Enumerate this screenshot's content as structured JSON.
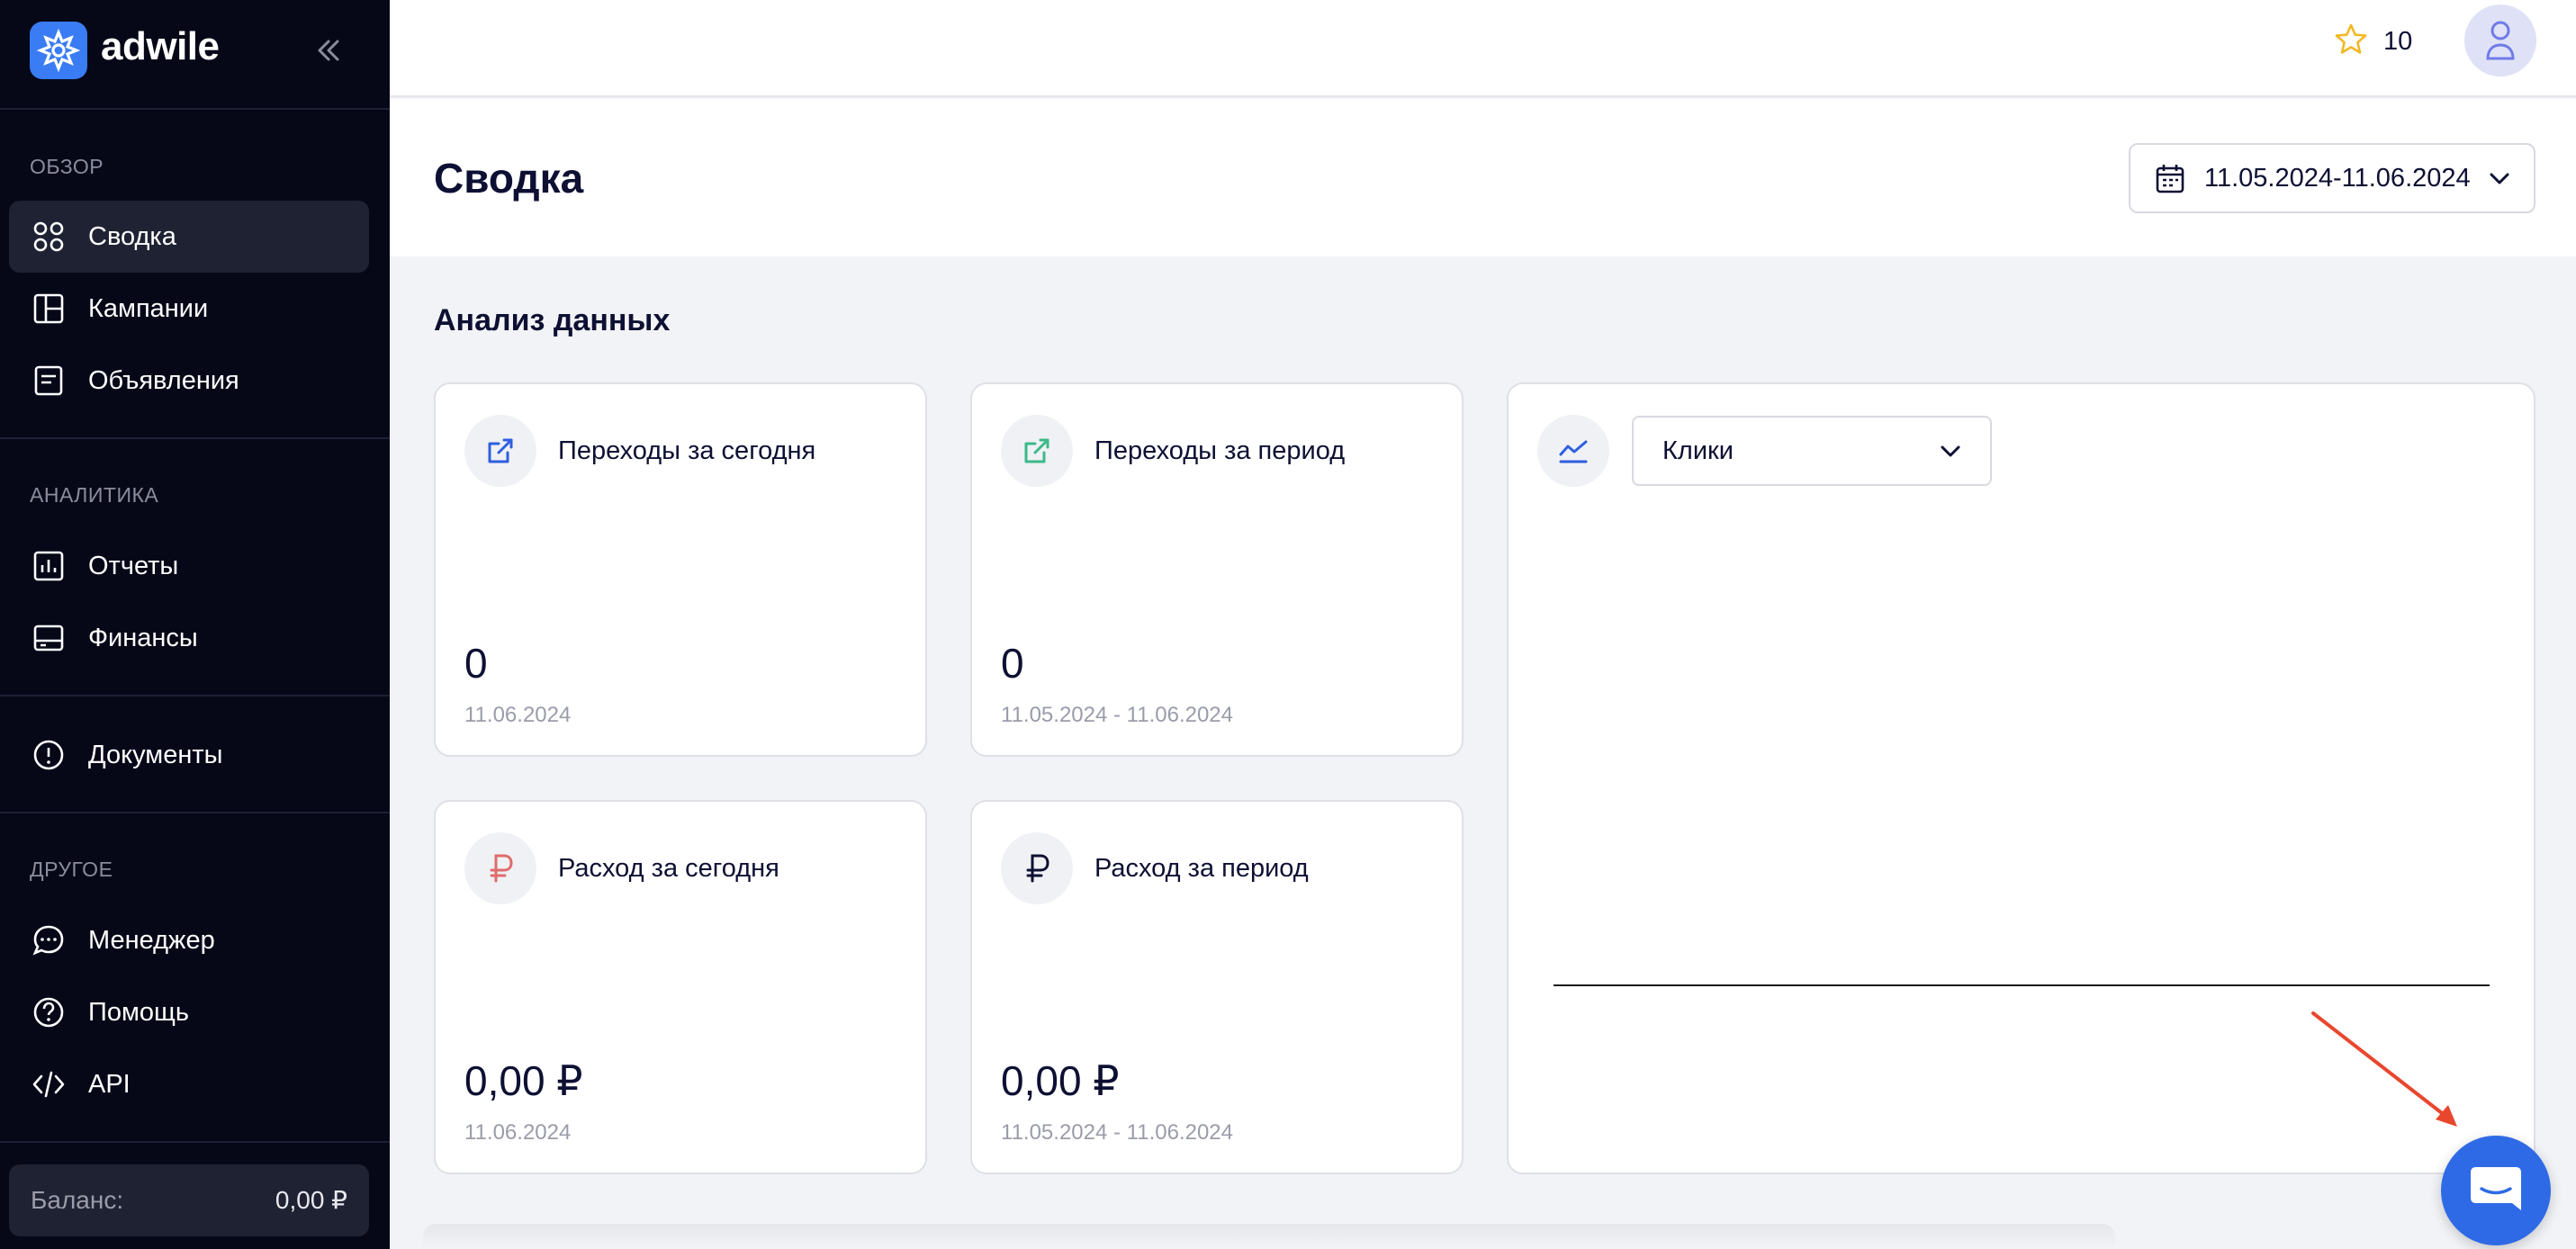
{
  "brand": {
    "name": "adwile",
    "color": "#3a7cf3"
  },
  "sidebar": {
    "sections": [
      {
        "label": "ОБЗОР",
        "items": [
          {
            "label": "Сводка",
            "icon": "grid-icon",
            "active": true
          },
          {
            "label": "Кампании",
            "icon": "layout-icon"
          },
          {
            "label": "Объявления",
            "icon": "document-icon"
          }
        ]
      },
      {
        "label": "АНАЛИТИКА",
        "items": [
          {
            "label": "Отчеты",
            "icon": "bar-chart-icon"
          },
          {
            "label": "Финансы",
            "icon": "wallet-icon"
          }
        ]
      },
      {
        "label": "",
        "items": [
          {
            "label": "Документы",
            "icon": "alert-circle-icon"
          }
        ]
      },
      {
        "label": "ДРУГОЕ",
        "items": [
          {
            "label": "Менеджер",
            "icon": "chat-icon"
          },
          {
            "label": "Помощь",
            "icon": "help-icon"
          },
          {
            "label": "API",
            "icon": "code-icon"
          }
        ]
      }
    ],
    "balance": {
      "label": "Баланс:",
      "value": "0,00 ₽"
    }
  },
  "topbar": {
    "stars": "10"
  },
  "page": {
    "title": "Сводка",
    "date_range": "11.05.2024-11.06.2024",
    "section_title": "Анализ данных"
  },
  "cards": [
    {
      "title": "Переходы за сегодня",
      "value": "0",
      "date": "11.06.2024",
      "icon": "external-link-icon",
      "icon_color": "#2f5fe0"
    },
    {
      "title": "Переходы за период",
      "value": "0",
      "date": "11.05.2024 - 11.06.2024",
      "icon": "external-link-icon",
      "icon_color": "#3bb98a"
    },
    {
      "title": "Расход за сегодня",
      "value": "0,00 ₽",
      "date": "11.06.2024",
      "icon": "ruble-icon",
      "icon_color": "#e06b6b"
    },
    {
      "title": "Расход за период",
      "value": "0,00 ₽",
      "date": "11.05.2024 - 11.06.2024",
      "icon": "ruble-icon",
      "icon_color": "#0d1033"
    }
  ],
  "chart_panel": {
    "metric": "Клики",
    "chart_data": {
      "type": "line",
      "series": [
        {
          "values": [
            0,
            0,
            0,
            0,
            0
          ]
        }
      ]
    }
  },
  "colors": {
    "sidebar_bg": "#060818",
    "accent": "#2f6ae6",
    "annotation_arrow": "#e8472e"
  }
}
